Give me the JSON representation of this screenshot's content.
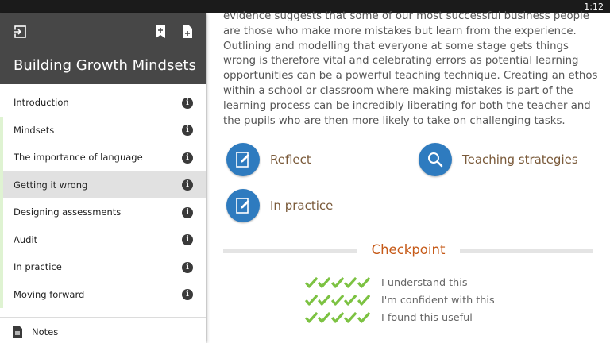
{
  "status_bar": {
    "time": "1:12"
  },
  "sidebar": {
    "title": "Building Growth Mindsets",
    "items": [
      {
        "label": "Introduction",
        "state": "default"
      },
      {
        "label": "Mindsets",
        "state": "complete"
      },
      {
        "label": "The importance of language",
        "state": "complete"
      },
      {
        "label": "Getting it wrong",
        "state": "active"
      },
      {
        "label": "Designing assessments",
        "state": "complete"
      },
      {
        "label": "Audit",
        "state": "complete"
      },
      {
        "label": "In practice",
        "state": "complete"
      },
      {
        "label": "Moving forward",
        "state": "complete"
      }
    ],
    "notes_label": "Notes"
  },
  "content": {
    "body": "evidence suggests that some of our most successful business people are those who make more mistakes but learn from the experience. Outlining and modelling that everyone at some stage gets things wrong is therefore vital and celebrating errors as potential learning opportunities can be a powerful teaching technique. Creating an ethos within a school or classroom where making mistakes is part of the learning process can be incredibly liberating for both the teacher and the pupils who are then more likely to take on challenging tasks.",
    "actions": {
      "reflect": "Reflect",
      "teaching": "Teaching strategies",
      "practice": "In practice"
    },
    "checkpoint": {
      "title": "Checkpoint",
      "rows": [
        {
          "label": "I understand this",
          "ticks": 5
        },
        {
          "label": "I'm confident with this",
          "ticks": 5
        },
        {
          "label": "I found this useful",
          "ticks": 5
        }
      ]
    }
  },
  "colors": {
    "header_bg": "#474747",
    "active_row": "#e1e1e1",
    "complete_marker": "#dff3d2",
    "action_circle": "#2e7bbf",
    "checkpoint_title": "#c65a18",
    "tick_green": "#7cc242"
  },
  "icons": {
    "exit": "exit-icon",
    "bookmark": "bookmark-add-icon",
    "note": "note-add-icon",
    "info": "info-icon",
    "notes": "notes-document-icon",
    "reflect": "pencil-note-icon",
    "teaching": "magnifier-icon",
    "practice": "pencil-note-icon",
    "tick": "check-icon"
  }
}
